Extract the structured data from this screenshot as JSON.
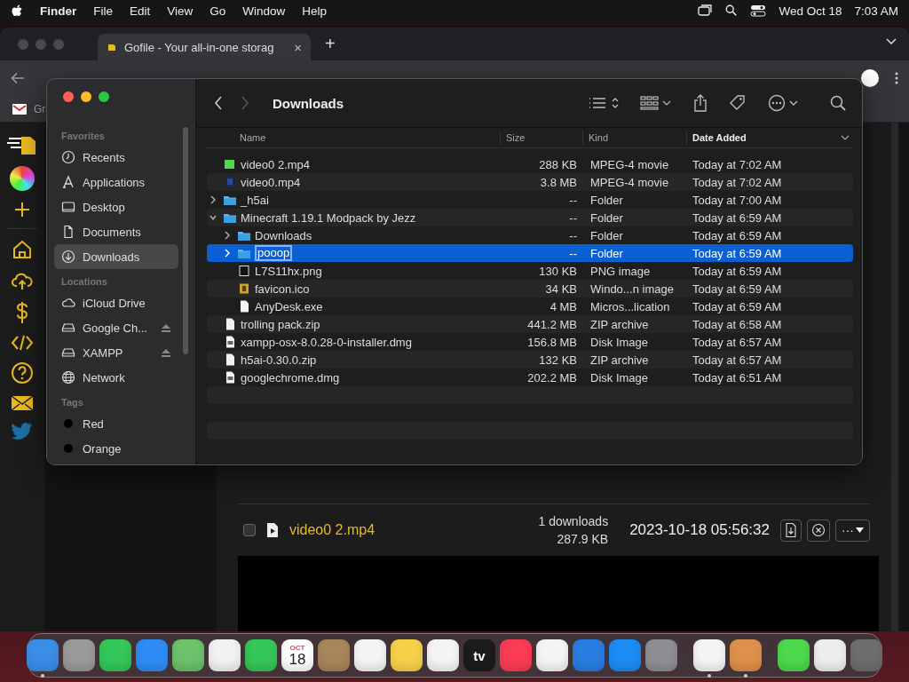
{
  "menu_bar": {
    "app": "Finder",
    "menus": [
      "File",
      "Edit",
      "View",
      "Go",
      "Window",
      "Help"
    ],
    "date": "Wed Oct 18",
    "time": "7:03 AM"
  },
  "browser": {
    "tab": {
      "title": "Gofile - Your all-in-one storag",
      "close": "×"
    },
    "new_tab": "+",
    "bookmark": "Gr",
    "page": {
      "file": {
        "checked": false,
        "name": "video0 2.mp4",
        "downloads": "1 downloads",
        "size": "287.9 KB",
        "date": "2023-10-18 05:56:32",
        "menu": "···"
      }
    }
  },
  "finder": {
    "title": "Downloads",
    "sidebar": [
      {
        "heading": "Favorites",
        "items": [
          {
            "label": "Recents",
            "selected": false
          },
          {
            "label": "Applications",
            "selected": false
          },
          {
            "label": "Desktop",
            "selected": false
          },
          {
            "label": "Documents",
            "selected": false
          },
          {
            "label": "Downloads",
            "selected": true
          }
        ]
      },
      {
        "heading": "Locations",
        "items": [
          {
            "label": "iCloud Drive",
            "selected": false,
            "eject": false
          },
          {
            "label": "Google Ch...",
            "selected": false,
            "eject": true
          },
          {
            "label": "XAMPP",
            "selected": false,
            "eject": true
          },
          {
            "label": "Network",
            "selected": false,
            "eject": false
          }
        ]
      },
      {
        "heading": "Tags",
        "items": [
          {
            "label": "Red",
            "selected": false,
            "color": "#000000"
          },
          {
            "label": "Orange",
            "selected": false,
            "color": "#000000"
          }
        ]
      }
    ],
    "columns": [
      "Name",
      "Size",
      "Kind",
      "Date Added"
    ],
    "rows": [
      {
        "kind": "thumbnail",
        "name": "video0 2.mp4",
        "size": "288 KB",
        "type": "MPEG-4 movie",
        "date": "Today at 7:02 AM",
        "selected": false,
        "editing": false
      },
      {
        "kind": "movie",
        "name": "video0.mp4",
        "size": "3.8 MB",
        "type": "MPEG-4 movie",
        "date": "Today at 7:02 AM",
        "selected": false,
        "editing": false
      },
      {
        "kind": "folder",
        "name": "_h5ai",
        "size": "--",
        "type": "Folder",
        "date": "Today at 7:00 AM",
        "selected": false,
        "editing": false,
        "expanded": false
      },
      {
        "kind": "folder",
        "name": "Minecraft 1.19.1 Modpack by Jezz",
        "size": "--",
        "type": "Folder",
        "date": "Today at 6:59 AM",
        "selected": false,
        "editing": false,
        "expanded": true,
        "children": [
          {
            "kind": "folder",
            "name": "Downloads",
            "size": "--",
            "type": "Folder",
            "date": "Today at 6:59 AM",
            "selected": false,
            "editing": false,
            "expanded": false
          },
          {
            "kind": "folder",
            "name": "pooop",
            "size": "--",
            "type": "Folder",
            "date": "Today at 6:59 AM",
            "selected": true,
            "editing": true,
            "expanded": false
          },
          {
            "kind": "image",
            "name": "L7S11hx.png",
            "size": "130 KB",
            "type": "PNG image",
            "date": "Today at 6:59 AM",
            "selected": false,
            "editing": false
          },
          {
            "kind": "icon",
            "name": "favicon.ico",
            "size": "34 KB",
            "type": "Windo...n image",
            "date": "Today at 6:59 AM",
            "selected": false,
            "editing": false
          },
          {
            "kind": "document",
            "name": "AnyDesk.exe",
            "size": "4 MB",
            "type": "Micros...lication",
            "date": "Today at 6:59 AM",
            "selected": false,
            "editing": false
          }
        ]
      },
      {
        "kind": "document",
        "name": "trolling pack.zip",
        "size": "441.2 MB",
        "type": "ZIP archive",
        "date": "Today at 6:58 AM",
        "selected": false,
        "editing": false
      },
      {
        "kind": "disk",
        "name": "xampp-osx-8.0.28-0-installer.dmg",
        "size": "156.8 MB",
        "type": "Disk Image",
        "date": "Today at 6:57 AM",
        "selected": false,
        "editing": false
      },
      {
        "kind": "document",
        "name": "h5ai-0.30.0.zip",
        "size": "132 KB",
        "type": "ZIP archive",
        "date": "Today at 6:57 AM",
        "selected": false,
        "editing": false
      },
      {
        "kind": "disk",
        "name": "googlechrome.dmg",
        "size": "202.2 MB",
        "type": "Disk Image",
        "date": "Today at 6:51 AM",
        "selected": false,
        "editing": false
      }
    ]
  },
  "dock": [
    {
      "kind": "app",
      "color": "#3a8ee6",
      "running": true
    },
    {
      "kind": "app",
      "color": "#9a9a9a",
      "running": false
    },
    {
      "kind": "app",
      "color": "#34c759",
      "running": false
    },
    {
      "kind": "app",
      "color": "#2f8cf5",
      "running": false
    },
    {
      "kind": "app",
      "color": "#6cc26a",
      "running": false
    },
    {
      "kind": "app",
      "color": "#f2f2f2",
      "running": false
    },
    {
      "kind": "app",
      "color": "#34c759",
      "running": false
    },
    {
      "kind": "calendar",
      "color": "#ffffff",
      "running": false,
      "month": "OCT",
      "day": "18"
    },
    {
      "kind": "app",
      "color": "#a8865a",
      "running": false
    },
    {
      "kind": "app",
      "color": "#f5f5f5",
      "running": false
    },
    {
      "kind": "app",
      "color": "#f7d14a",
      "running": false
    },
    {
      "kind": "app",
      "color": "#f5f5f5",
      "running": false
    },
    {
      "kind": "label",
      "color": "#1c1c1e",
      "running": false,
      "text": "tv"
    },
    {
      "kind": "app",
      "color": "#fa3c55",
      "running": false
    },
    {
      "kind": "app",
      "color": "#f5f5f5",
      "running": false
    },
    {
      "kind": "app",
      "color": "#2a7de1",
      "running": false
    },
    {
      "kind": "app",
      "color": "#1b8cf4",
      "running": false
    },
    {
      "kind": "app",
      "color": "#8e8e93",
      "running": false
    },
    {
      "kind": "separator"
    },
    {
      "kind": "app",
      "color": "#f5f5f5",
      "running": true
    },
    {
      "kind": "app",
      "color": "#e0904a",
      "running": true
    },
    {
      "kind": "separator"
    },
    {
      "kind": "app",
      "color": "#4cd94c",
      "running": false
    },
    {
      "kind": "app",
      "color": "#eeeeee",
      "running": false
    },
    {
      "kind": "app",
      "color": "#6e6e6e",
      "running": false
    }
  ]
}
